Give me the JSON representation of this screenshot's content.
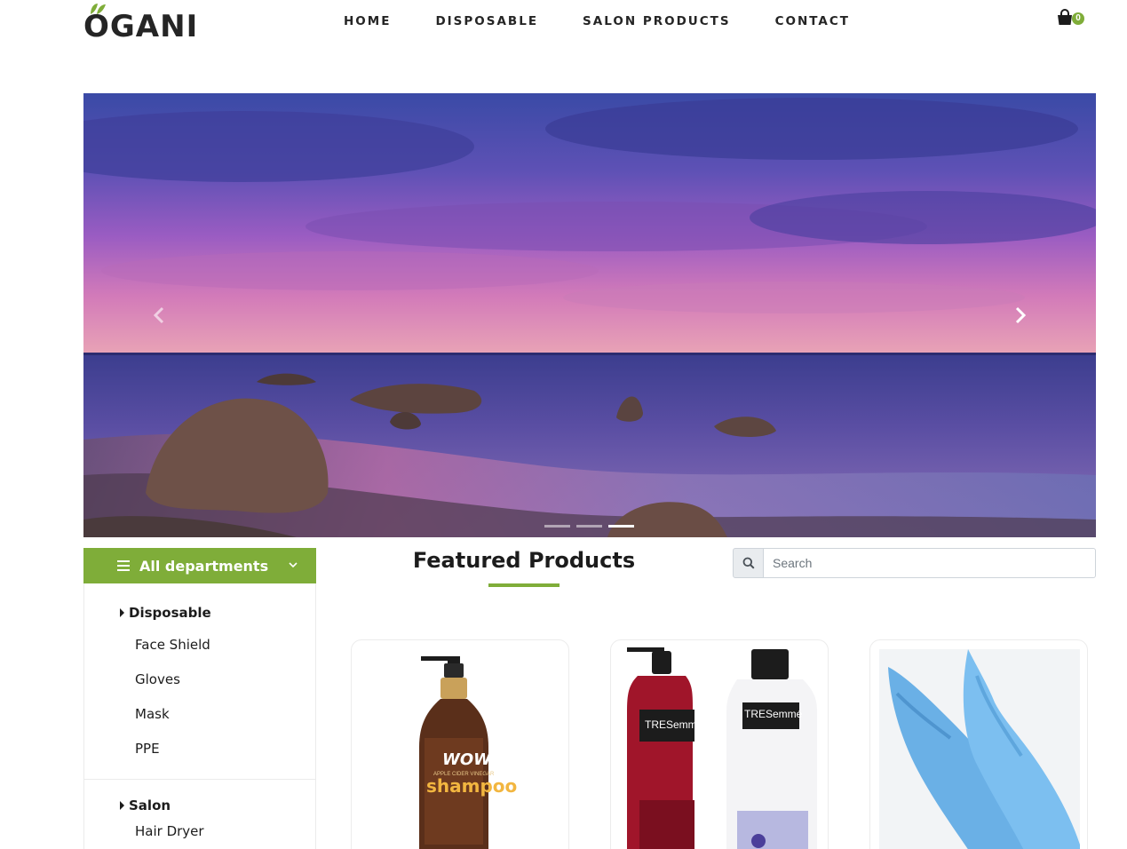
{
  "brand": {
    "logo_text": "OGANI",
    "accent": "#7fad39"
  },
  "nav": {
    "items": [
      {
        "label": "HOME"
      },
      {
        "label": "DISPOSABLE"
      },
      {
        "label": "SALON PRODUCTS"
      },
      {
        "label": "CONTACT"
      }
    ]
  },
  "cart": {
    "icon": "shopping-bag-icon",
    "count": "0"
  },
  "hero": {
    "prev_icon": "chevron-left-icon",
    "next_icon": "chevron-right-icon",
    "slides": 3,
    "active_slide": 3
  },
  "departments": {
    "title": "All departments",
    "groups": [
      {
        "name": "Disposable",
        "items": [
          "Face Shield",
          "Gloves",
          "Mask",
          "PPE"
        ]
      },
      {
        "name": "Salon",
        "items": [
          "Hair Dryer"
        ]
      }
    ]
  },
  "featured": {
    "title": "Featured Products"
  },
  "search": {
    "placeholder": "Search",
    "icon": "search-icon"
  },
  "products": [
    {
      "image": "wow-shampoo-bottle",
      "brand": "WOW",
      "name": "shampoo",
      "subtitle": "APPLE CIDER VINEGAR"
    },
    {
      "image": "tresemme-bottles",
      "brand_left": "TRESemmé",
      "brand_right": "TRESemmé"
    },
    {
      "image": "blue-nitrile-gloves"
    }
  ]
}
